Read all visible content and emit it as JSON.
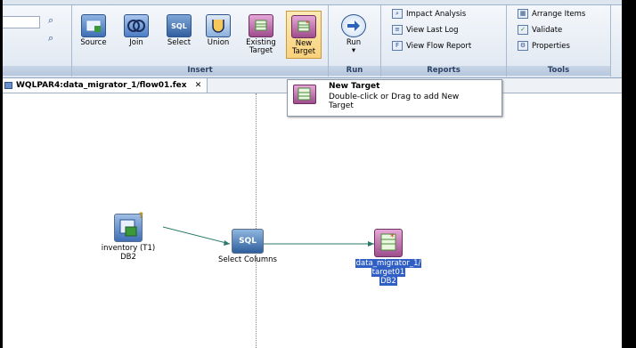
{
  "ribbon": {
    "insert_group": {
      "label": "Insert",
      "buttons": [
        "Source",
        "Join",
        "Select",
        "Union",
        "Existing Target",
        "New Target"
      ],
      "existing_line1": "Existing",
      "existing_line2": "Target",
      "new_line1": "New",
      "new_line2": "Target"
    },
    "run_group": {
      "label": "Run",
      "button": "Run",
      "dropdown": "▾"
    },
    "reports_group": {
      "label": "Reports",
      "items": [
        "Impact Analysis",
        "View Last Log",
        "View Flow Report"
      ]
    },
    "tools_group": {
      "label": "Tools",
      "items": [
        "Arrange Items",
        "Validate",
        "Properties"
      ]
    }
  },
  "tab": {
    "title": "WQLPAR4:data_migrator_1/flow01.fex",
    "close": "✕"
  },
  "tooltip": {
    "title": "New Target",
    "body_line1": "Double-click or Drag to add New",
    "body_line2": "Target"
  },
  "nodes": {
    "source": {
      "label_line1": "inventory (T1)",
      "label_line2": "DB2",
      "badge": "?"
    },
    "select": {
      "icon_text": "SQL",
      "label": "Select Columns"
    },
    "target": {
      "label_line1": "data_migrator_1/",
      "label_line2": "target01",
      "label_line3": "DB2"
    }
  },
  "icons": {
    "sql_button_text": "SQL"
  },
  "colors": {
    "selection": "#2f5fc4",
    "ribbon_accent": "#2e4466",
    "selected_button": "#f9d27c"
  }
}
